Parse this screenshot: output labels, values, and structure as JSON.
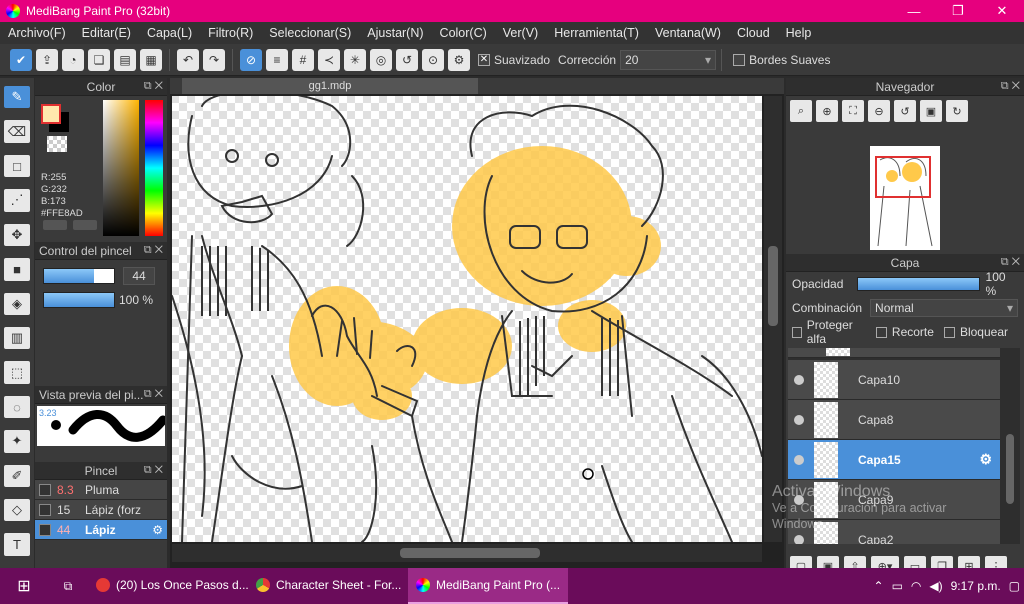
{
  "window": {
    "title": "MediBang Paint Pro (32bit)",
    "controls": [
      "—",
      "❐",
      "✕"
    ]
  },
  "menu": [
    "Archivo(F)",
    "Editar(E)",
    "Capa(L)",
    "Filtro(R)",
    "Seleccionar(S)",
    "Ajustar(N)",
    "Color(C)",
    "Ver(V)",
    "Herramienta(T)",
    "Ventana(W)",
    "Cloud",
    "Help"
  ],
  "toolbar": {
    "smoothing_label": "Suavizado",
    "correction_label": "Corrección",
    "correction_value": "20",
    "soft_edges_label": "Bordes Suaves"
  },
  "color_panel": {
    "title": "Color",
    "r": "R:255",
    "g": "G:232",
    "b": "B:173",
    "hex": "#FFE8AD",
    "fg_color": "#FFE8AD"
  },
  "brush_control": {
    "title": "Control del pincel",
    "size_value": "44",
    "size_fraction": 0.72,
    "opacity_value": "100 %"
  },
  "brush_preview": {
    "title": "Vista previa del pi...",
    "size_text": "3.23"
  },
  "pencil_panel": {
    "title": "Pincel",
    "brushes": [
      {
        "size": "8.3",
        "name": "Pluma"
      },
      {
        "size": "15",
        "name": "Lápiz (forz"
      },
      {
        "size": "44",
        "name": "Lápiz"
      }
    ]
  },
  "canvas": {
    "tab": "gg1.mdp"
  },
  "navigator": {
    "title": "Navegador"
  },
  "layer_panel": {
    "title": "Capa",
    "opacity_label": "Opacidad",
    "opacity_value": "100 %",
    "blend_label": "Combinación",
    "blend_value": "Normal",
    "protect_alpha": "Proteger alfa",
    "clipping": "Recorte",
    "lock": "Bloquear",
    "layers": [
      "Capa10",
      "Capa8",
      "Capa15",
      "Capa9",
      "Capa2"
    ],
    "active_layer": "Capa15"
  },
  "watermark": {
    "line1": "Activar Windows",
    "line2": "Ve a Configuración para activar",
    "line3": "Windows."
  },
  "taskbar": {
    "items": [
      {
        "label": "(20) Los Once Pasos d...",
        "icon_color": "#e53935"
      },
      {
        "label": "Character Sheet - For...",
        "icon_color": "#fbc02d"
      },
      {
        "label": "MediBang Paint Pro (...",
        "icon_color": "#e6007e"
      }
    ],
    "time": "9:17 p.m."
  }
}
